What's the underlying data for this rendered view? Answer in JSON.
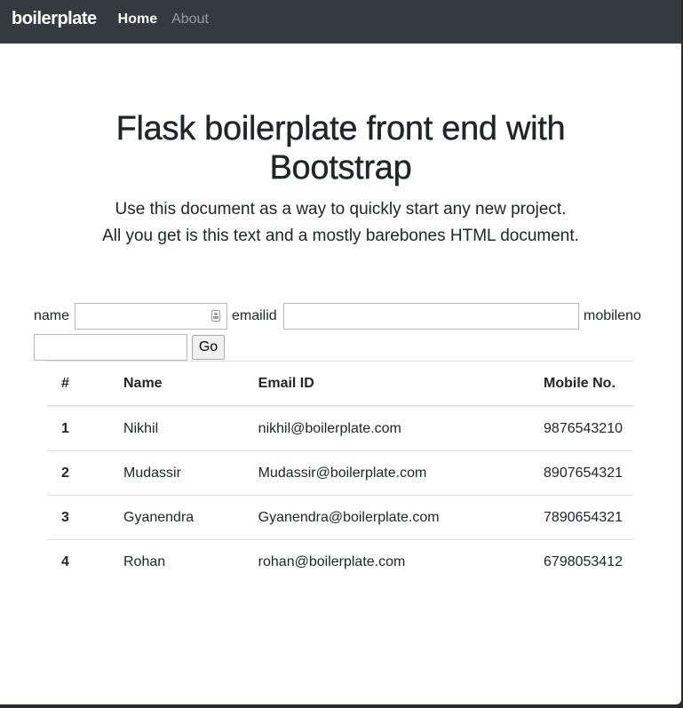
{
  "navbar": {
    "brand": "boilerplate",
    "links": [
      {
        "label": "Home"
      },
      {
        "label": "About"
      }
    ]
  },
  "hero": {
    "title": "Flask boilerplate front end with Bootstrap",
    "lead_line1": "Use this document as a way to quickly start any new project.",
    "lead_line2": "All you get is this text and a mostly barebones HTML document."
  },
  "form": {
    "name_label": "name",
    "name_value": "",
    "email_label": "emailid",
    "email_value": "",
    "mobile_label": "mobileno",
    "mobile_value": "",
    "submit_label": "Go",
    "name_field_icon": "contact-card-icon"
  },
  "table": {
    "headers": [
      "#",
      "Name",
      "Email ID",
      "Mobile No."
    ],
    "rows": [
      [
        "1",
        "Nikhil",
        "nikhil@boilerplate.com",
        "9876543210"
      ],
      [
        "2",
        "Mudassir",
        "Mudassir@boilerplate.com",
        "8907654321"
      ],
      [
        "3",
        "Gyanendra",
        "Gyanendra@boilerplate.com",
        "7890654321"
      ],
      [
        "4",
        "Rohan",
        "rohan@boilerplate.com",
        "6798053412"
      ]
    ]
  },
  "colors": {
    "navbar_bg": "#343a40",
    "text": "#212529",
    "nav_muted": "#9a9da0"
  }
}
